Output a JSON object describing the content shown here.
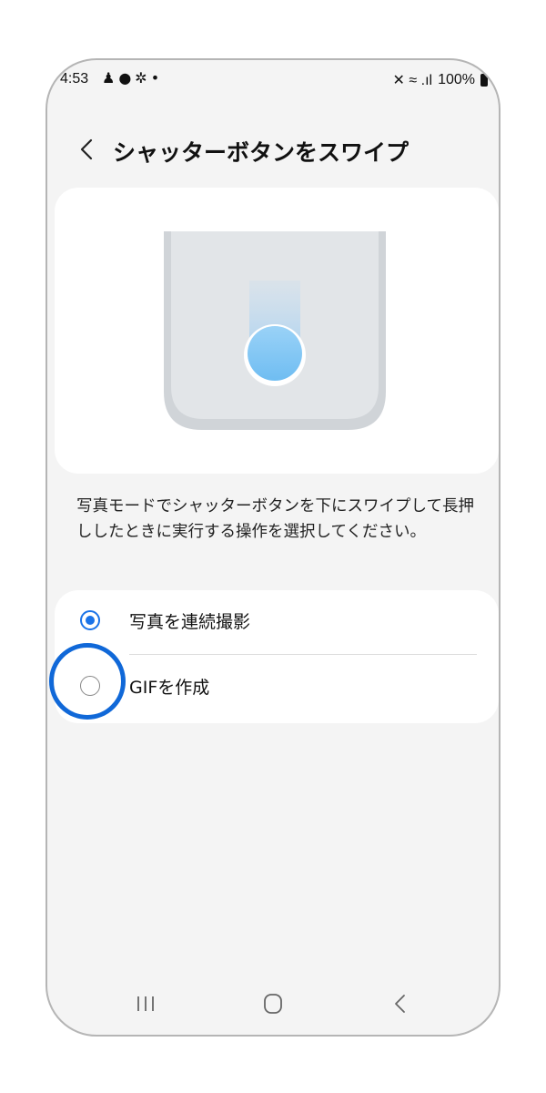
{
  "status_bar": {
    "time": "4:53",
    "left_icons": "♟●✲•",
    "right_icons": "✕ ≈ .ıl",
    "battery_text": "100%"
  },
  "header": {
    "title": "シャッターボタンをスワイプ"
  },
  "description": "写真モードでシャッターボタンを下にスワイプして長押ししたときに実行する操作を選択してください。",
  "options": [
    {
      "label": "写真を連続撮影",
      "selected": true
    },
    {
      "label": "GIFを作成",
      "selected": false
    }
  ],
  "colors": {
    "accent": "#1a73e8",
    "highlight_ring": "#1068d8",
    "background": "#f4f4f4",
    "card": "#ffffff"
  },
  "nav": {
    "recents_icon": "recents-icon",
    "home_icon": "home-icon",
    "back_icon": "back-icon"
  }
}
